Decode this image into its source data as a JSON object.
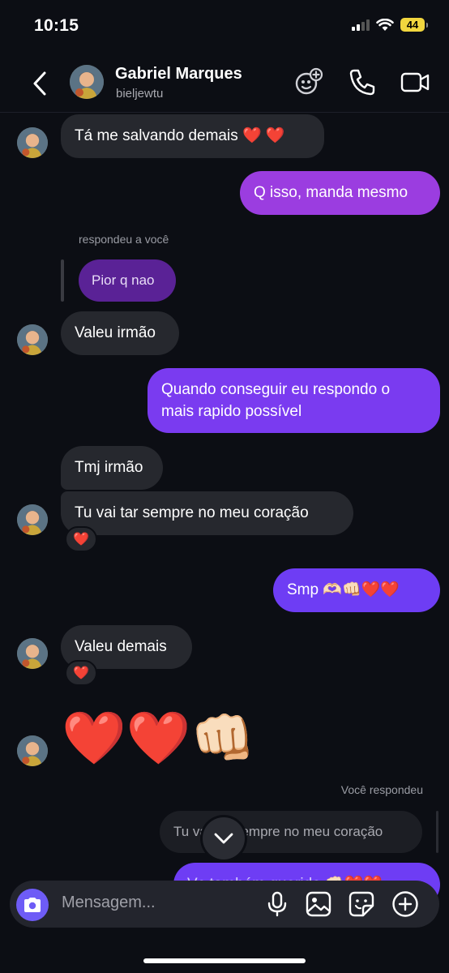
{
  "status_bar": {
    "time": "10:15",
    "battery": "44"
  },
  "header": {
    "name": "Gabriel Marques",
    "username": "bieljewtu"
  },
  "messages": {
    "m1": "Tá me salvando demais ❤️ ❤️",
    "m2": "Q isso, manda mesmo",
    "reply_label": "respondeu a você",
    "quoted": "Pior q nao",
    "m3": "Valeu irmão",
    "m4_line1": "Quando conseguir eu respondo o",
    "m4_line2": "mais rapido possível",
    "m5": "Tmj irmão",
    "m6": "Tu vai tar sempre no meu coração",
    "m7": "Smp 🫶🏻👊🏻❤️❤️",
    "m8": "Valeu demais",
    "m9": "❤️❤️👊🏻",
    "you_replied_label": "Você respondeu",
    "quoted2": "Tu vai tar sempre no meu coração",
    "m10": "Vc também querido 👊🏻❤️❤️",
    "reaction": "❤️"
  },
  "composer": {
    "placeholder": "Mensagem..."
  },
  "colors": {
    "accent_purple": "#9b3de0",
    "accent_violet": "#6e3df4",
    "camera": "#6e5cf6"
  }
}
